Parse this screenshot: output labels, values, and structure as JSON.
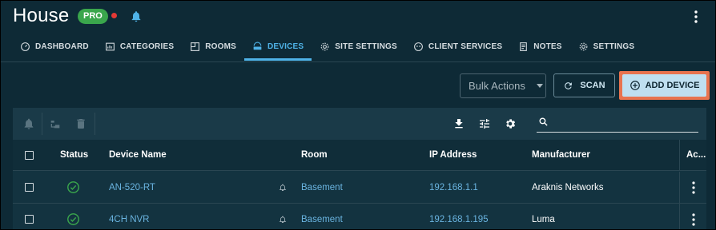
{
  "header": {
    "title": "House",
    "badge": "PRO"
  },
  "tabs": [
    {
      "label": "DASHBOARD",
      "icon": "dashboard-icon"
    },
    {
      "label": "CATEGORIES",
      "icon": "categories-icon"
    },
    {
      "label": "ROOMS",
      "icon": "rooms-icon"
    },
    {
      "label": "DEVICES",
      "icon": "devices-icon",
      "active": true
    },
    {
      "label": "SITE SETTINGS",
      "icon": "gear-icon"
    },
    {
      "label": "CLIENT SERVICES",
      "icon": "client-services-icon"
    },
    {
      "label": "NOTES",
      "icon": "notes-icon"
    },
    {
      "label": "SETTINGS",
      "icon": "gear-icon"
    }
  ],
  "toolbar": {
    "bulk_actions": "Bulk Actions",
    "scan": "SCAN",
    "add_device": "ADD DEVICE"
  },
  "search": {
    "placeholder": ""
  },
  "table": {
    "columns": [
      "Status",
      "Device Name",
      "Room",
      "IP Address",
      "Manufacturer",
      "Ac..."
    ],
    "rows": [
      {
        "device_name": "AN-520-RT",
        "room": "Basement",
        "ip": "192.168.1.1",
        "manufacturer": "Araknis Networks"
      },
      {
        "device_name": "4CH NVR",
        "room": "Basement",
        "ip": "192.168.1.195",
        "manufacturer": "Luma"
      }
    ]
  },
  "colors": {
    "background": "#0e2a36",
    "accent": "#4fb3e8",
    "badge": "#3aa64c",
    "highlight": "#e8734f",
    "status_ok": "#3aa64c"
  }
}
